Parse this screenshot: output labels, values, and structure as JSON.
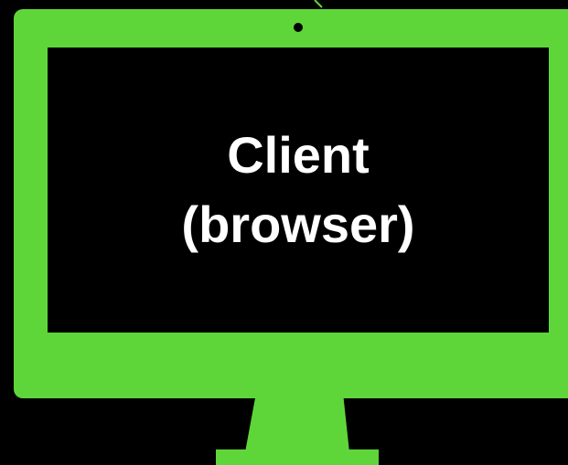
{
  "monitor": {
    "label_lines": [
      "Client",
      "(browser)"
    ]
  },
  "colors": {
    "background": "#000000",
    "monitor_frame": "#5ed639",
    "screen": "#000000",
    "text": "#ffffff"
  },
  "icons": {
    "camera": "camera-dot-icon",
    "stand": "monitor-stand-icon"
  }
}
